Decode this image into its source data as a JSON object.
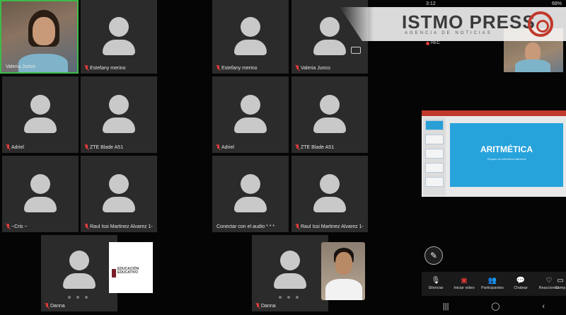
{
  "status_bar": {
    "time": "3:12",
    "battery": "68%"
  },
  "watermark": {
    "brand": "ISTMO PRESS",
    "tagline": "AGENCIA DE NOTICIAS"
  },
  "left_grid": {
    "tiles": [
      {
        "name": "Valeria Junco",
        "is_self_video": true,
        "muted": false
      },
      {
        "name": "Estefany merino",
        "muted": true
      },
      {
        "name": "Adriel",
        "muted": true
      },
      {
        "name": "ZTE Blade A51",
        "muted": true
      },
      {
        "name": "~Cris ~",
        "muted": true
      },
      {
        "name": "Raul Issi Martinez Alvarez 1-",
        "muted": true
      },
      {
        "name": "Danna",
        "muted": true
      }
    ]
  },
  "right_grid": {
    "tiles": [
      {
        "name": "Estefany merino",
        "muted": true
      },
      {
        "name": "Valeria Junco",
        "muted": true
      },
      {
        "name": "Adriel",
        "muted": true
      },
      {
        "name": "ZTE Blade A51",
        "muted": true
      },
      {
        "name": "Conectar con el audio * * *",
        "muted": false
      },
      {
        "name": "Raul Issi Martinez Alvarez 1-",
        "muted": true
      },
      {
        "name": "Danna",
        "muted": true
      }
    ]
  },
  "recording": {
    "label": "REC"
  },
  "slide": {
    "title": "ARITMÉTICA",
    "subtitle": "Repaso de aritmética adicional"
  },
  "logo_pip": {
    "line1": "EDUCACIÓN",
    "line2": "EDUCATIVO",
    "line3": "..."
  },
  "toolbar": {
    "items": [
      {
        "icon": "mic-icon",
        "label": "Silenciar"
      },
      {
        "icon": "video-off-icon",
        "label": "Iniciar video"
      },
      {
        "icon": "participants-icon",
        "label": "Participantes"
      },
      {
        "icon": "chat-icon",
        "label": "Chatear"
      },
      {
        "icon": "reactions-icon",
        "label": "Reacciones"
      },
      {
        "icon": "more-icon",
        "label": "Comp"
      }
    ]
  },
  "navbar": {
    "recent": "|||",
    "home": "◯",
    "back": "‹"
  },
  "colors": {
    "active_speaker_border": "#3dbb4a",
    "muted_mic": "#e23b3b",
    "slide_bg": "#27a3dc",
    "brand_red": "#c0392b"
  }
}
